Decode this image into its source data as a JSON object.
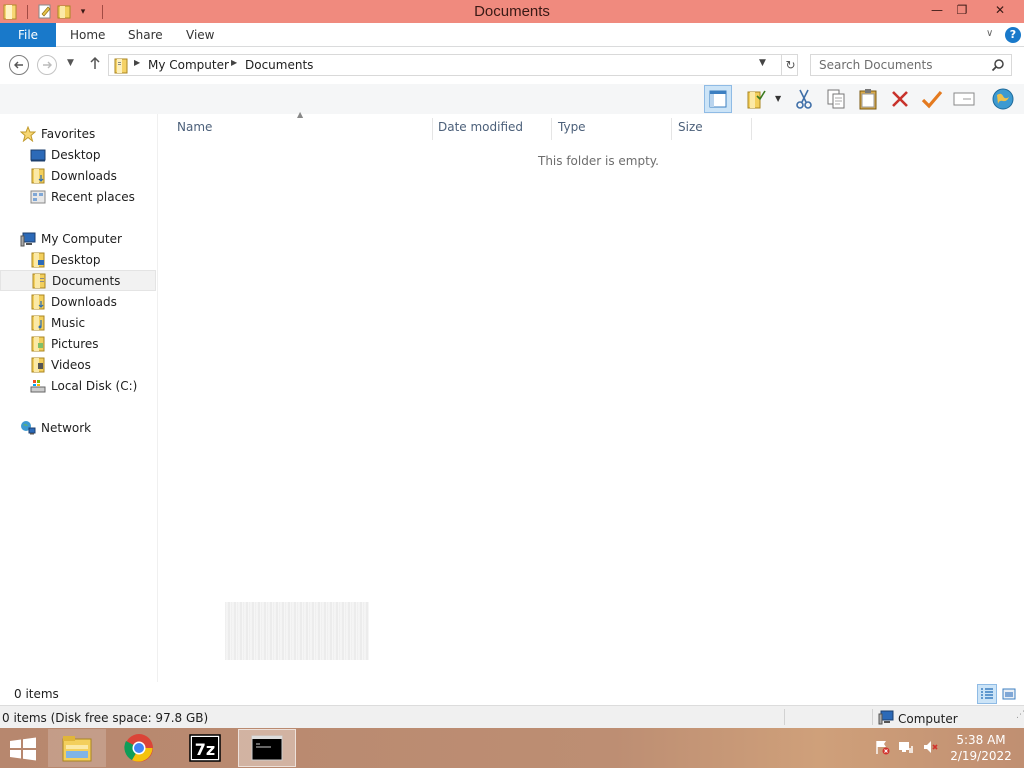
{
  "window": {
    "title": "Documents",
    "controls": {
      "minimize": "—",
      "restore": "❐",
      "close": "✕"
    }
  },
  "ribbon": {
    "file_tab": "File",
    "tabs": [
      "Home",
      "Share",
      "View"
    ],
    "help": "?"
  },
  "address": {
    "breadcrumbs": [
      "My Computer",
      "Documents"
    ],
    "search_placeholder": "Search Documents"
  },
  "toolbar": {
    "buttons": [
      "preview-pane",
      "folder-options",
      "cut",
      "copy",
      "paste",
      "delete",
      "check",
      "rename",
      "internet"
    ]
  },
  "navigation": {
    "favorites": {
      "label": "Favorites",
      "items": [
        "Desktop",
        "Downloads",
        "Recent places"
      ]
    },
    "computer": {
      "label": "My Computer",
      "items": [
        "Desktop",
        "Documents",
        "Downloads",
        "Music",
        "Pictures",
        "Videos",
        "Local Disk (C:)"
      ],
      "selected": "Documents"
    },
    "network": {
      "label": "Network"
    }
  },
  "columns": [
    "Name",
    "Date modified",
    "Type",
    "Size"
  ],
  "content": {
    "empty_message": "This folder is empty."
  },
  "status": {
    "item_count": "0 items",
    "details": "0 items (Disk free space: 97.8 GB)",
    "location": "Computer"
  },
  "taskbar": {
    "apps": [
      "file-explorer",
      "chrome",
      "7-zip",
      "command-prompt"
    ],
    "time": "5:38 AM",
    "date": "2/19/2022"
  },
  "colors": {
    "titlebar": "#f08a7e",
    "file_tab": "#1979ca",
    "taskbar": "#b7876e"
  }
}
